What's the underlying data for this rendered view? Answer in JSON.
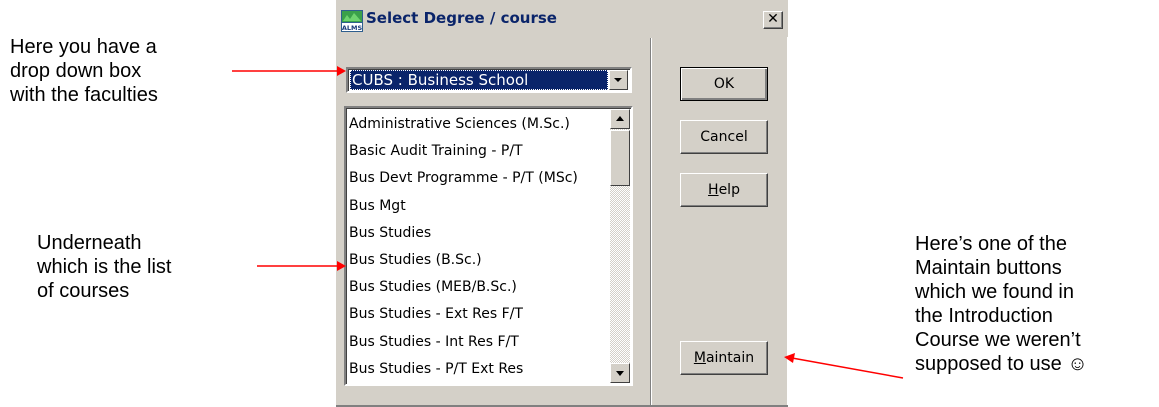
{
  "annotations": {
    "faculties": [
      "Here you have a",
      "drop down box",
      "with the faculties"
    ],
    "courses": [
      "Underneath",
      "which is the list",
      "of courses"
    ],
    "maintain": [
      "Here’s one of the",
      "Maintain buttons",
      "which we found in",
      "the Introduction",
      "Course we weren’t",
      "supposed to use ☺"
    ]
  },
  "dialog": {
    "title": "Select Degree / course",
    "app_icon_text": "ALMS",
    "close_label": "✕",
    "faculty_combo": {
      "selected": "CUBS : Business School"
    },
    "courses": [
      "Administrative Sciences (M.Sc.)",
      "Basic Audit Training - P/T",
      "Bus Devt Programme - P/T (MSc)",
      "Bus Mgt",
      "Bus Studies",
      "Bus Studies (B.Sc.)",
      "Bus Studies (MEB/B.Sc.)",
      "Bus Studies - Ext Res F/T",
      "Bus Studies - Int Res F/T",
      "Bus Studies - P/T Ext Res"
    ],
    "buttons": {
      "ok": "OK",
      "cancel": "Cancel",
      "help_mnemonic": "H",
      "help_rest": "elp",
      "maintain_mnemonic": "M",
      "maintain_rest": "aintain"
    }
  },
  "colors": {
    "arrow": "#ff0000",
    "selection": "#0a246a",
    "face": "#d4d0c8"
  }
}
